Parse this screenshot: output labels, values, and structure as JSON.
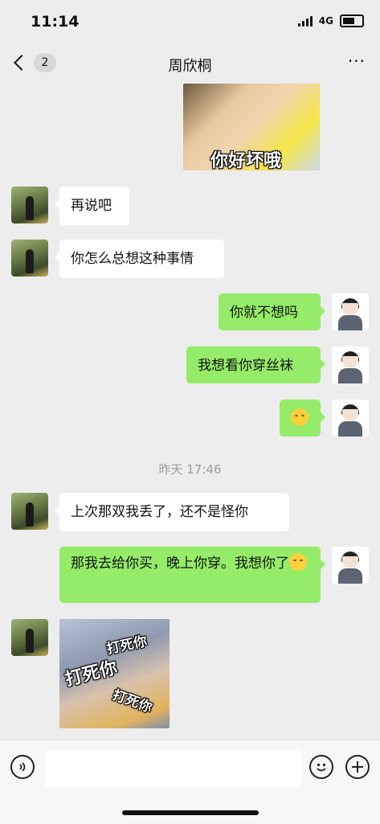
{
  "status_bar": {
    "time": "11:14",
    "network": "4G"
  },
  "nav": {
    "unread_count": "2",
    "title": "周欣桐",
    "more": "···"
  },
  "messages": [
    {
      "side": "left",
      "text": "再说吧"
    },
    {
      "side": "left",
      "text": "你怎么总想这种事情"
    },
    {
      "side": "right",
      "text": "你就不想吗"
    },
    {
      "side": "right",
      "text": "我想看你穿丝袜"
    },
    {
      "side": "right",
      "text": ""
    },
    {
      "side": "left",
      "text": "上次那双我丢了，还不是怪你"
    },
    {
      "side": "right",
      "text": "那我去给你买，晚上你穿。我想你了"
    }
  ],
  "timestamp": "昨天 17:46",
  "stickers": {
    "top": {
      "caption": "你好坏哦"
    },
    "bottom": {
      "lines": [
        "打死你",
        "打死你",
        "打死你"
      ]
    }
  },
  "input": {
    "placeholder": ""
  },
  "icons": [
    "voice-icon",
    "emoji-icon",
    "plus-icon",
    "back-chevron-icon",
    "more-icon"
  ],
  "colors": {
    "green_bubble": "#95ec69",
    "background": "#ededed"
  }
}
